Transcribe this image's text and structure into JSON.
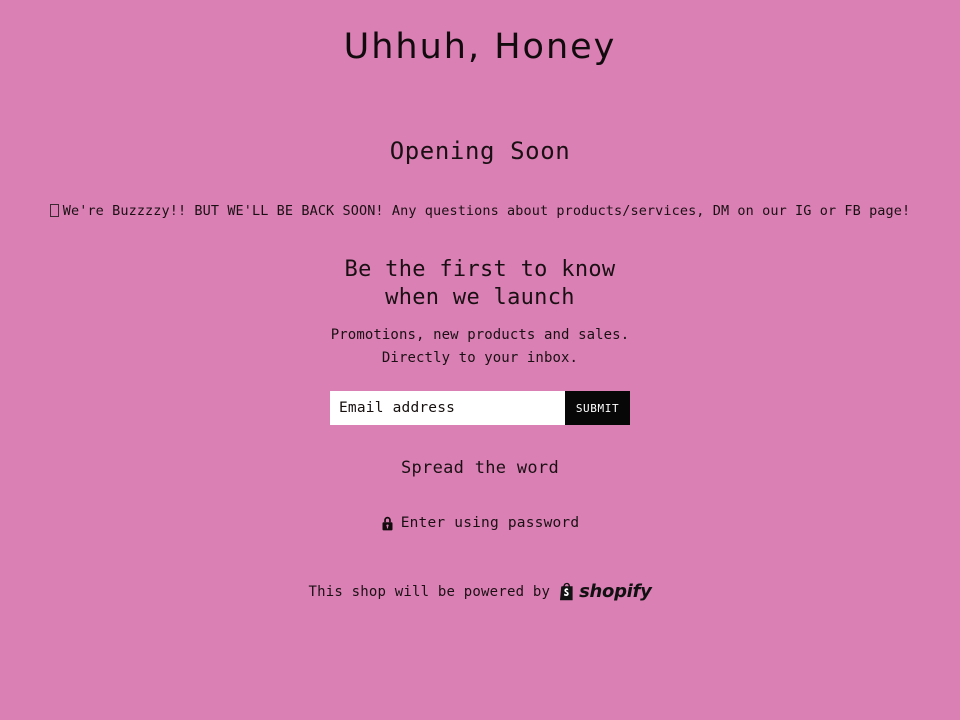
{
  "theme": {
    "background_color": "#db80b4",
    "text_color": "#1a1014",
    "button_background": "#070707",
    "button_text": "#ffffff",
    "input_background": "#ffffff"
  },
  "shop": {
    "title": "Uhhuh, Honey"
  },
  "main": {
    "heading": "Opening Soon",
    "message_icon": "missing-glyph-box",
    "message": "We're Buzzzzy!! BUT WE'LL BE BACK SOON! Any questions about products/services, DM on our IG or FB page!"
  },
  "newsletter": {
    "heading_line1": "Be the first to know when",
    "heading_line2": "we launch",
    "subtext_line1": "Promotions, new products and sales.",
    "subtext_line2": "Directly to your inbox.",
    "email_placeholder": "Email address",
    "email_value": "",
    "submit_label": "SUBMIT"
  },
  "share": {
    "heading": "Spread the word"
  },
  "password": {
    "icon": "lock-icon",
    "label": "Enter using password"
  },
  "footer": {
    "text": "This shop will be powered by",
    "logo_icon": "shopify-bag-icon",
    "logo_wordmark": "shopify"
  }
}
